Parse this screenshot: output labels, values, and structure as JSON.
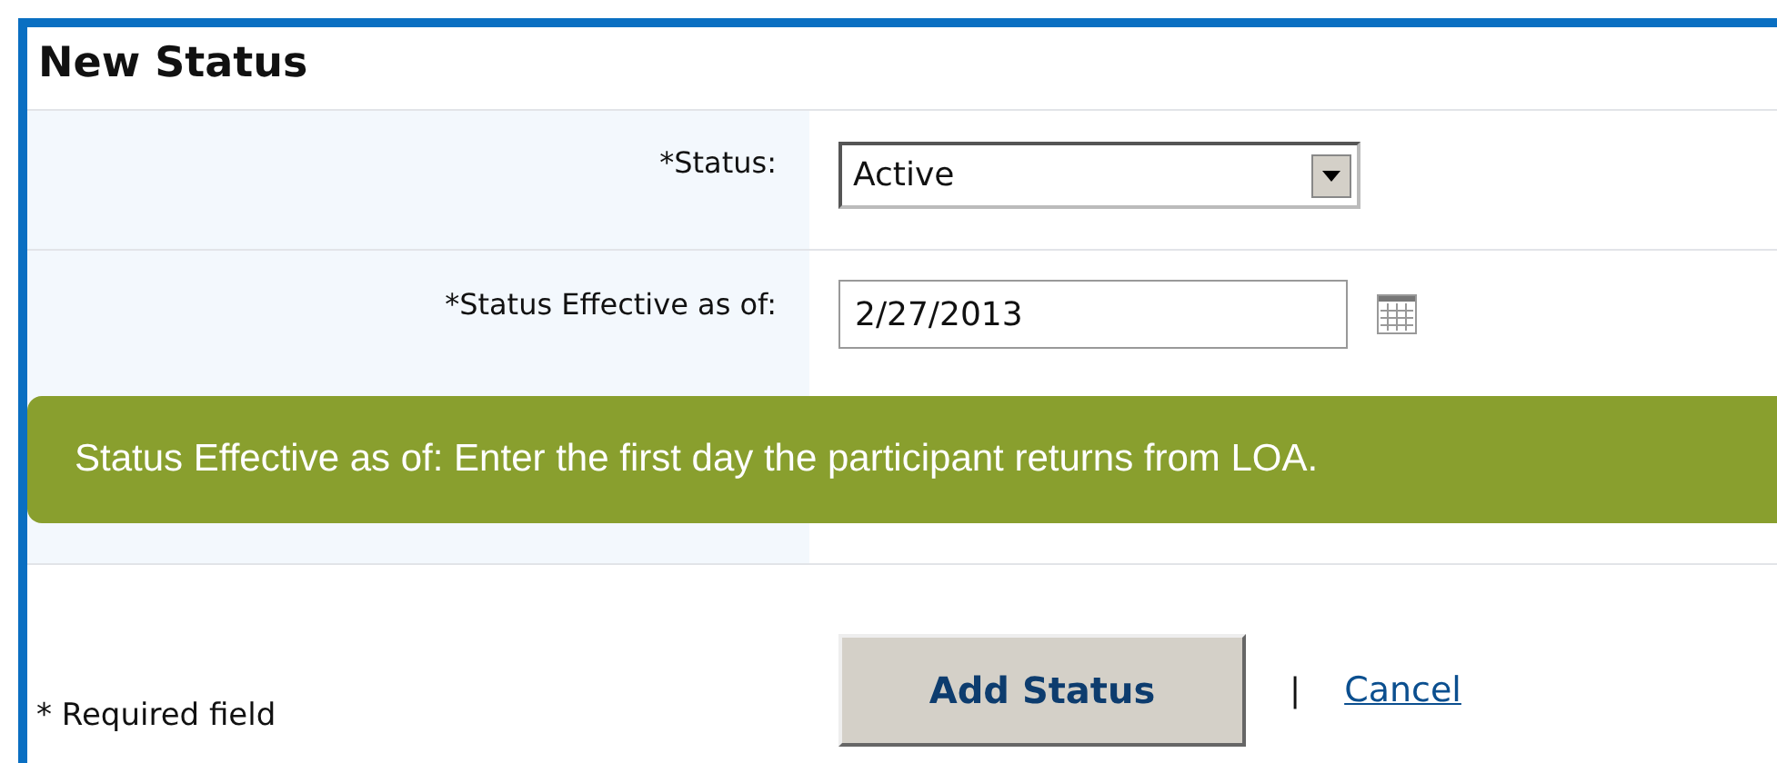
{
  "panel": {
    "title": "New Status"
  },
  "fields": [
    {
      "kind": "select",
      "label": "*Status:",
      "value": "Active"
    },
    {
      "kind": "date",
      "label": "*Status Effective as of:",
      "value": "2/27/2013"
    }
  ],
  "tooltip": {
    "text": "Status Effective as of: Enter the first day the participant returns from LOA."
  },
  "footer": {
    "note": "* Required field",
    "primary_button": "Add Status",
    "separator": "|",
    "link": "Cancel"
  }
}
